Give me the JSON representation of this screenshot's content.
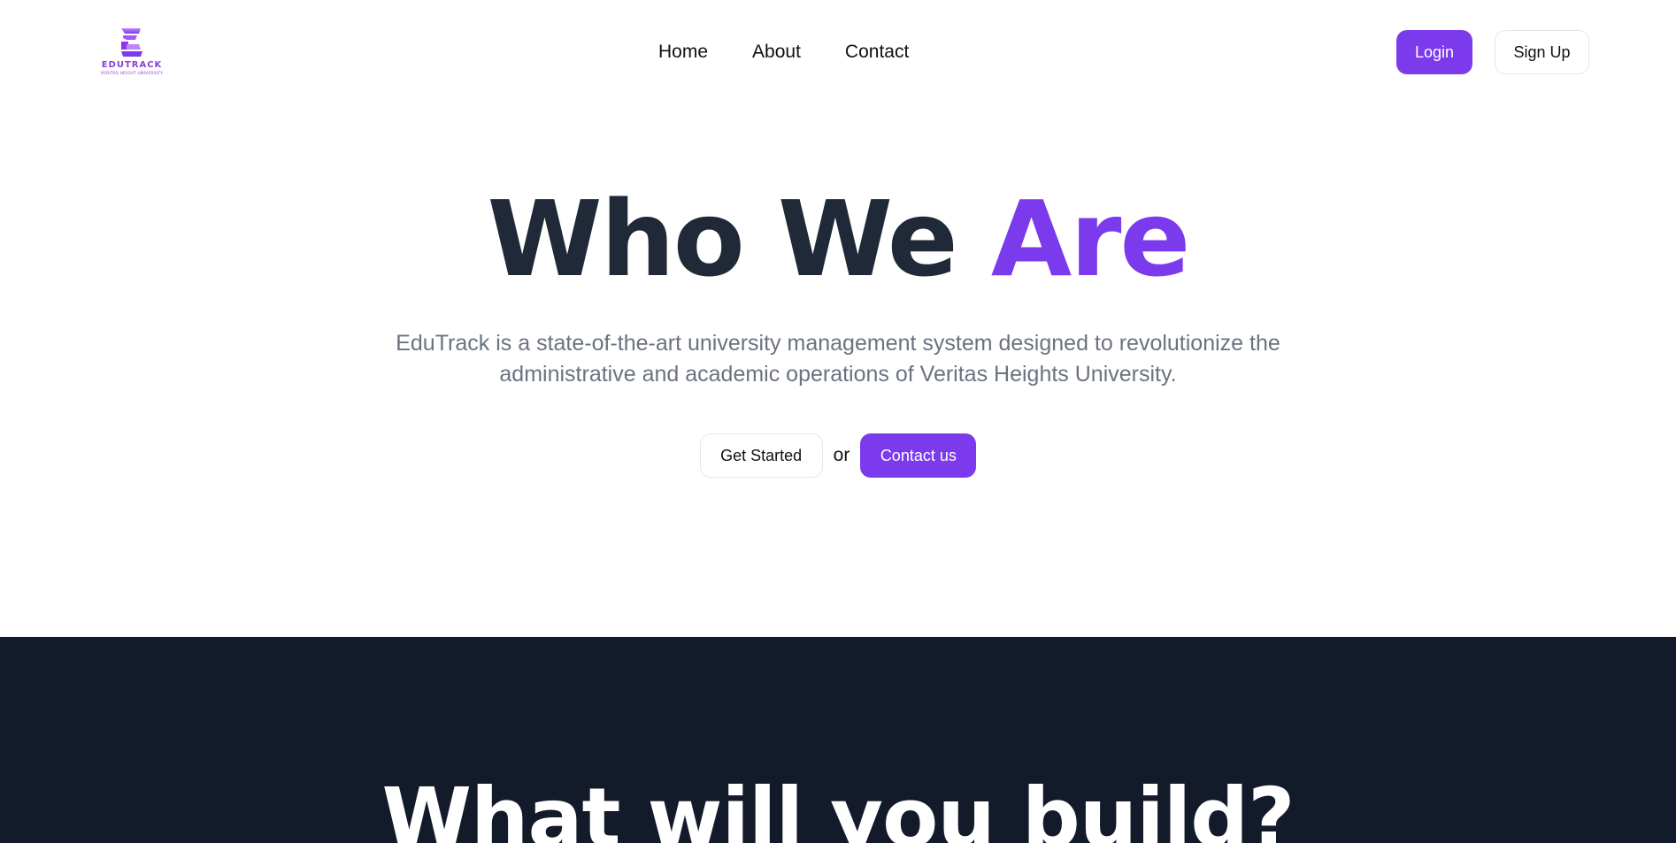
{
  "brand": {
    "name": "EDUTRACK",
    "subtitle": "VERITAS HEIGHT UNIVERSITY",
    "accent_color": "#7c3aed",
    "logo_icon": "edutrack-e-logo-icon"
  },
  "nav": {
    "items": [
      "Home",
      "About",
      "Contact"
    ]
  },
  "auth": {
    "login_label": "Login",
    "signup_label": "Sign Up"
  },
  "hero": {
    "title_main": "Who We ",
    "title_accent": "Are",
    "description": "EduTrack is a state-of-the-art university management system designed to revolutionize the administrative and academic operations of Veritas Heights University.",
    "get_started_label": "Get Started",
    "or_text": "or",
    "contact_label": "Contact us"
  },
  "section2": {
    "title": "What will you build?",
    "background_color": "#131a2a"
  }
}
